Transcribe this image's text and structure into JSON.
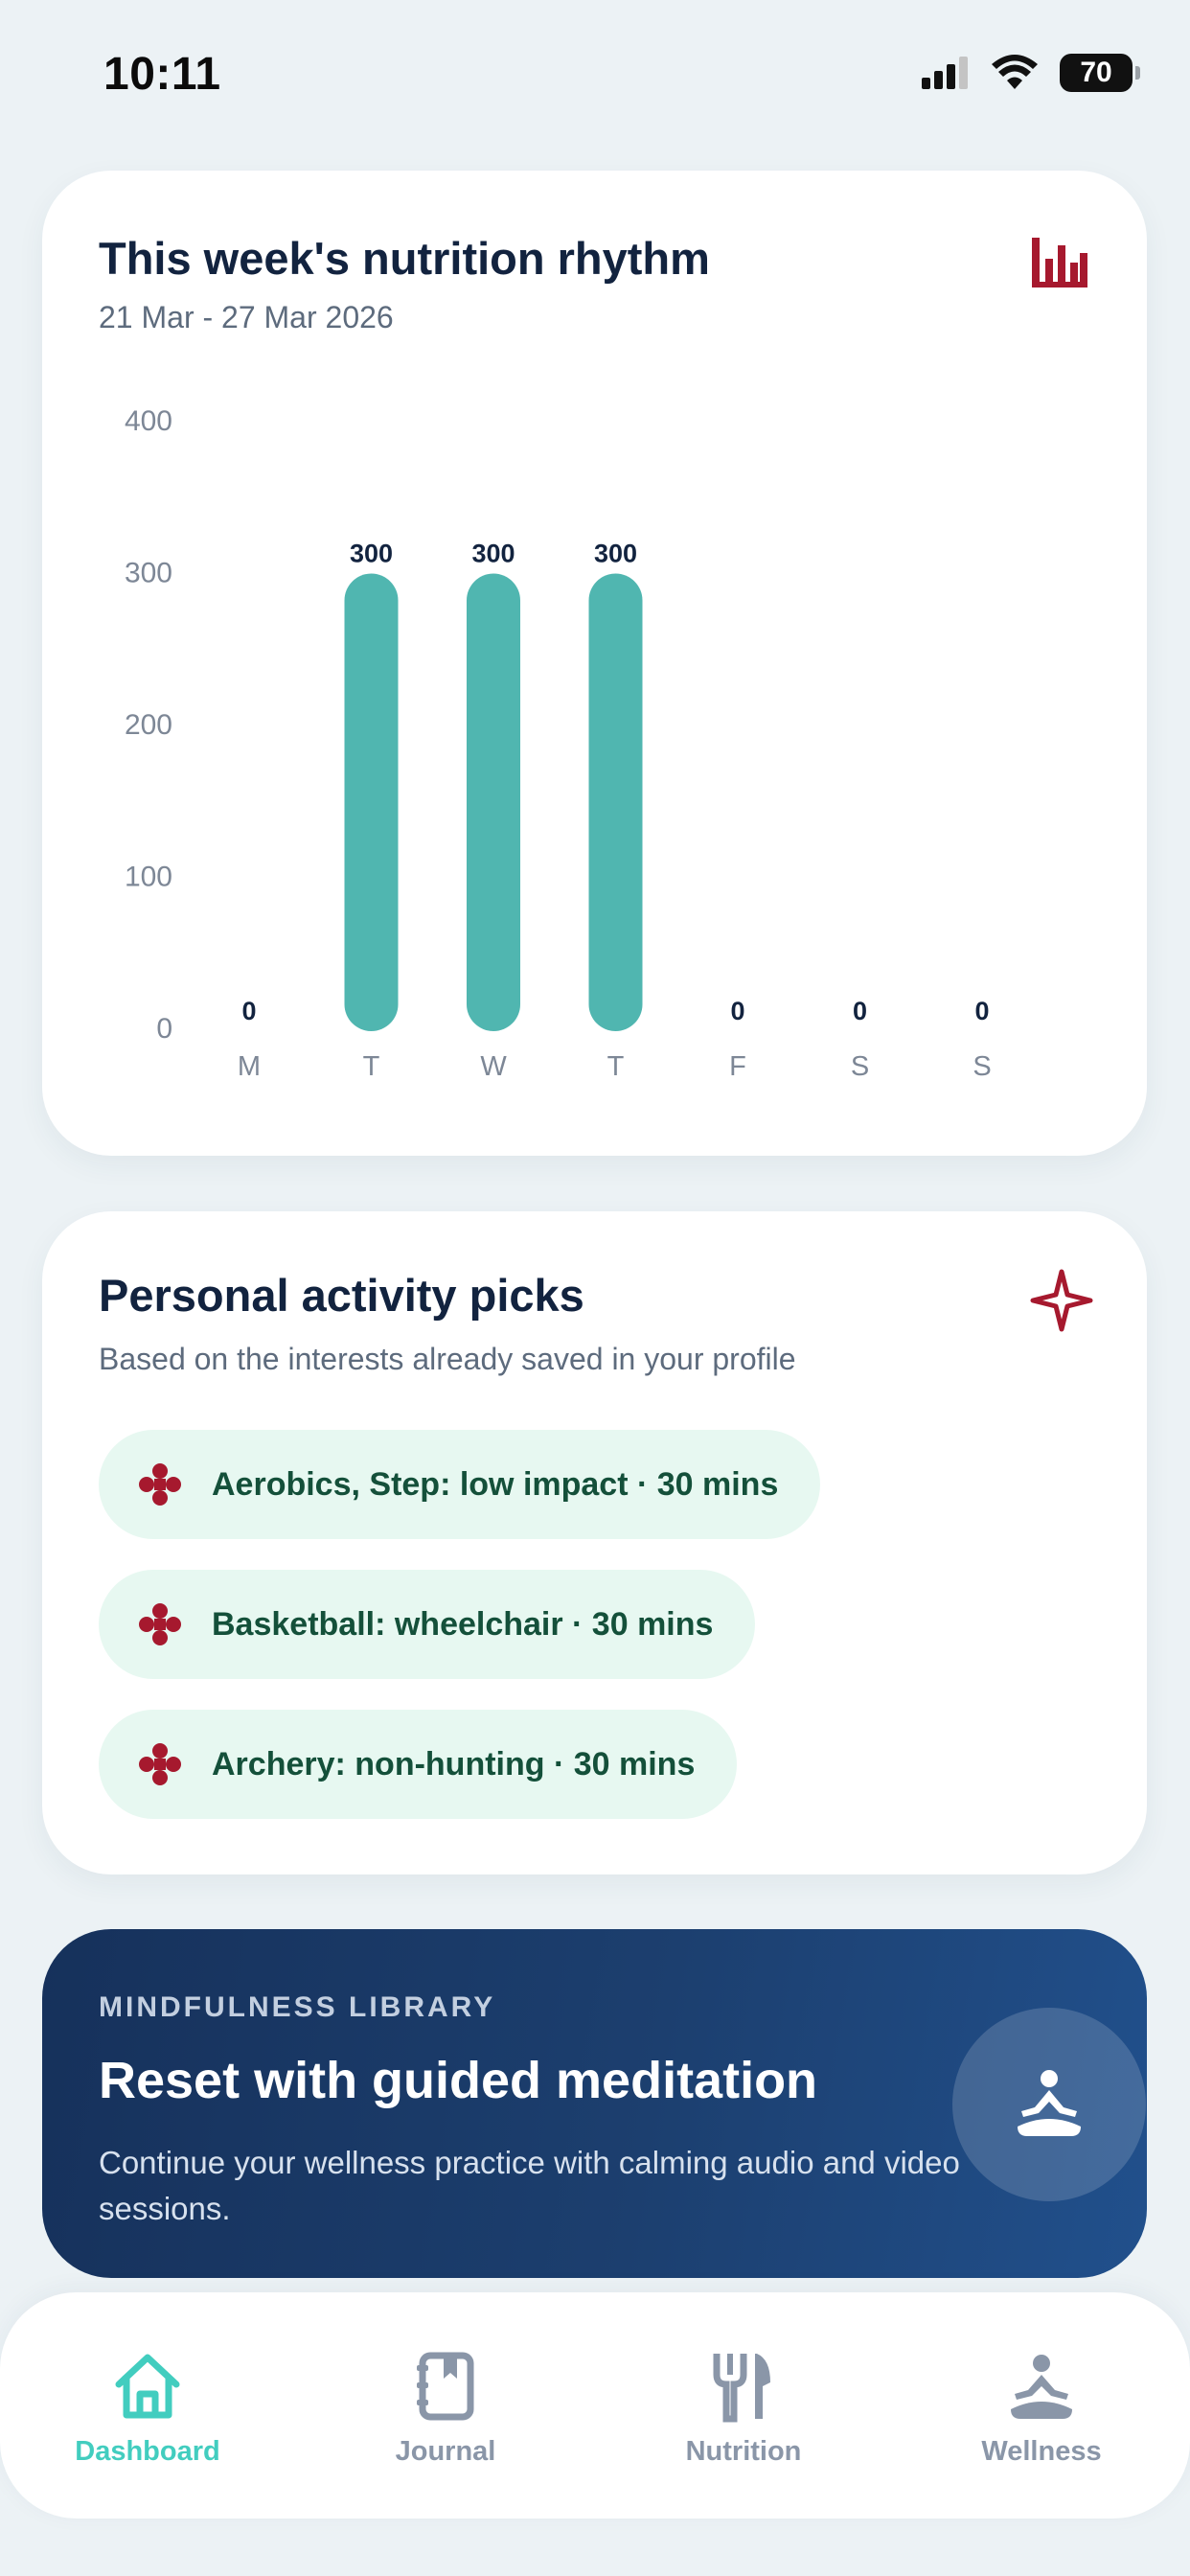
{
  "status_bar": {
    "time": "10:11",
    "battery": "70",
    "icons": [
      "signal-icon",
      "wifi-icon",
      "battery-icon"
    ]
  },
  "nutrition_card": {
    "title": "This week's nutrition rhythm",
    "date_range": "21 Mar - 27 Mar 2026",
    "icon": "bar-chart-icon"
  },
  "chart_data": {
    "type": "bar",
    "categories": [
      "M",
      "T",
      "W",
      "T",
      "F",
      "S",
      "S"
    ],
    "values": [
      0,
      300,
      300,
      300,
      0,
      0,
      0
    ],
    "yticks": [
      0,
      100,
      200,
      300,
      400
    ],
    "ylim": [
      0,
      400
    ],
    "bar_color": "#50b6b0",
    "grid": false
  },
  "activity_card": {
    "title": "Personal activity picks",
    "subtitle": "Based on the interests already saved in your profile",
    "icon": "sparkle-icon",
    "items": [
      {
        "label": "Aerobics, Step: low impact · 30 mins",
        "icon": "activity-cross-icon"
      },
      {
        "label": "Basketball: wheelchair · 30 mins",
        "icon": "activity-cross-icon"
      },
      {
        "label": "Archery: non-hunting · 30 mins",
        "icon": "activity-cross-icon"
      }
    ]
  },
  "mindfulness_banner": {
    "kicker": "MINDFULNESS LIBRARY",
    "title": "Reset with guided meditation",
    "description": "Continue your wellness practice with calming audio and video sessions.",
    "icon": "meditation-icon"
  },
  "bottom_nav": {
    "items": [
      {
        "label": "Dashboard",
        "icon": "home-icon",
        "active": true
      },
      {
        "label": "Journal",
        "icon": "journal-icon",
        "active": false
      },
      {
        "label": "Nutrition",
        "icon": "fork-knife-icon",
        "active": false
      },
      {
        "label": "Wellness",
        "icon": "meditation-icon",
        "active": false
      }
    ]
  },
  "colors": {
    "accent": "#42cdbf",
    "brand_red": "#a6192e",
    "navy": "#12233f",
    "pill_bg": "#e7f8f1"
  }
}
